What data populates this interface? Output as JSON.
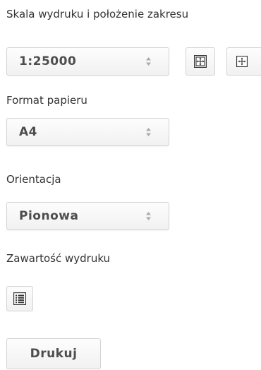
{
  "scale": {
    "label": "Skala wydruku i położenie zakresu",
    "value": "1:25000"
  },
  "icons": {
    "select_arrows": "updown-arrows-icon",
    "fit_extent": "fit-extent-icon",
    "move_extent": "move-extent-icon",
    "content_list": "list-icon"
  },
  "paper": {
    "label": "Format papieru",
    "value": "A4"
  },
  "orientation": {
    "label": "Orientacja",
    "value": "Pionowa"
  },
  "content": {
    "label": "Zawartość wydruku"
  },
  "print": {
    "label": "Drukuj"
  }
}
